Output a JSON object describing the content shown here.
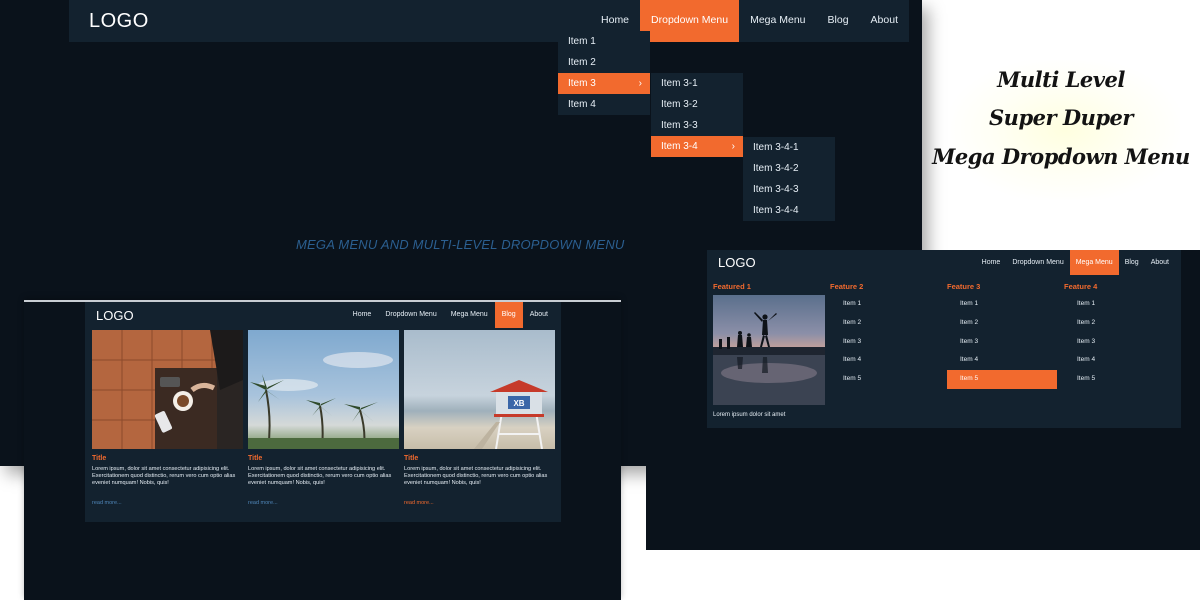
{
  "showcase_title": {
    "line1": "Multi Level",
    "line2": "Super Duper",
    "line3": "Mega Dropdown Menu"
  },
  "screen_dropdown": {
    "logo": "LOGO",
    "nav": [
      "Home",
      "Dropdown Menu",
      "Mega Menu",
      "Blog",
      "About"
    ],
    "active_nav": "Dropdown Menu",
    "level1": [
      "Item 1",
      "Item 2",
      "Item 3",
      "Item 4"
    ],
    "level2": [
      "Item 3-1",
      "Item 3-2",
      "Item 3-3",
      "Item 3-4"
    ],
    "level3": [
      "Item 3-4-1",
      "Item 3-4-2",
      "Item 3-4-3",
      "Item 3-4-4"
    ],
    "caption": "MEGA MENU AND MULTI-LEVEL DROPDOWN MENU"
  },
  "screen_mega": {
    "logo": "LOGO",
    "nav": [
      "Home",
      "Dropdown Menu",
      "Mega Menu",
      "Blog",
      "About"
    ],
    "active_nav": "Mega Menu",
    "featured_title": "Featured 1",
    "featured_desc": "Lorem ipsum dolor sit amet",
    "columns": [
      {
        "title": "Feature 2",
        "items": [
          "Item 1",
          "Item 2",
          "Item 3",
          "Item 4",
          "Item 5"
        ]
      },
      {
        "title": "Feature 3",
        "items": [
          "Item 1",
          "Item 2",
          "Item 3",
          "Item 4",
          "Item 5"
        ],
        "active_item": "Item 5"
      },
      {
        "title": "Feature 4",
        "items": [
          "Item 1",
          "Item 2",
          "Item 3",
          "Item 4",
          "Item 5"
        ]
      }
    ]
  },
  "screen_blog": {
    "logo": "LOGO",
    "nav": [
      "Home",
      "Dropdown Menu",
      "Mega Menu",
      "Blog",
      "About"
    ],
    "active_nav": "Blog",
    "cards": [
      {
        "title": "Title",
        "text": "Lorem ipsum, dolor sit amet consectetur adipisicing elit. Exercitationem quod distinctio, rerum vero cum optio alias eveniet numquam! Nobis, quis!",
        "more": "read more..."
      },
      {
        "title": "Title",
        "text": "Lorem ipsum, dolor sit amet consectetur adipisicing elit. Exercitationem quod distinctio, rerum vero cum optio alias eveniet numquam! Nobis, quis!",
        "more": "read more..."
      },
      {
        "title": "Title",
        "text": "Lorem ipsum, dolor sit amet consectetur adipisicing elit. Exercitationem quod distinctio, rerum vero cum optio alias eveniet numquam! Nobis, quis!",
        "more": "read more..."
      }
    ]
  },
  "colors": {
    "accent": "#f26a2e",
    "nav_bg": "#13222f",
    "page_bg": "#0a121b",
    "caption": "#2b5f90",
    "link": "#4f86b8"
  }
}
